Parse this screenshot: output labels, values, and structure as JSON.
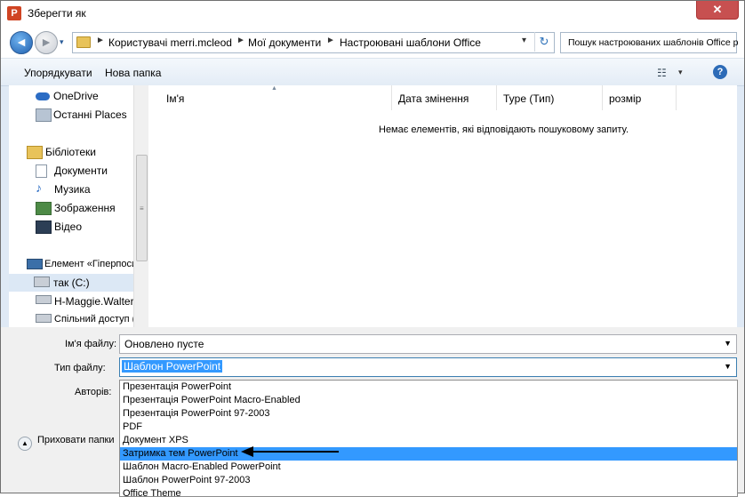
{
  "window": {
    "title": "Зберегти як",
    "close_glyph": "✕",
    "app_icon": "P"
  },
  "nav": {
    "back_glyph": "◄",
    "forward_glyph": "►",
    "history_glyph": "▾"
  },
  "breadcrumb": [
    "Користувачі mеrri.mcleod",
    "Мої документи",
    "Настроювані шаблони Office"
  ],
  "breadcrumb_sep": "►",
  "refresh_glyph": "↻",
  "search": {
    "placeholder": "Пошук настроюваних шаблонів Office р"
  },
  "toolbar": {
    "organize": "Упорядкувати",
    "new_folder": "Нова папка",
    "view_glyph": "☷",
    "view_drop": "▾",
    "help_glyph": "?"
  },
  "navpane": {
    "items": [
      {
        "label": "OneDrive",
        "icon": "cloud-icon"
      },
      {
        "label": "Останні Places",
        "icon": "recent-places-icon"
      },
      {
        "label": "Бібліотеки",
        "icon": "libraries-icon"
      },
      {
        "label": "Документи",
        "icon": "documents-icon"
      },
      {
        "label": "Музика",
        "icon": "music-icon"
      },
      {
        "label": "Зображення",
        "icon": "pictures-icon"
      },
      {
        "label": "Відео",
        "icon": "video-icon"
      },
      {
        "label": "Елемент «Гіперпосилання» в колекції «Стилі клітинок»",
        "icon": "computer-icon"
      },
      {
        "label": "так (C:)",
        "icon": "drive-icon"
      },
      {
        "label": "H-Maggie.Walter",
        "icon": "network-drive-icon"
      },
      {
        "label": "Спільний доступ (W:)",
        "icon": "network-drive-icon"
      }
    ]
  },
  "columns": [
    "Ім'я",
    "Дата змінення",
    "Type (Тип)",
    "розмір"
  ],
  "empty_message": "Немає елементів, які відповідають пошуковому запиту.",
  "fields": {
    "filename_label": "Ім'я файлу:",
    "filename_value": "Оновлено пусте",
    "filetype_label": "Тип файлу:",
    "filetype_value": "Шаблон PowerPoint",
    "authors_label": "Авторів:",
    "dropdown_glyph": "▼",
    "hide_folders": "Приховати папки",
    "hide_glyph": "▲"
  },
  "filetype_options": [
    "Презентація PowerPoint",
    "Презентація PowerPoint Macro-Enabled",
    "Презентація PowerPoint 97-2003",
    "PDF",
    "Документ XPS",
    "Затримка тем PowerPoint",
    "Шаблон Macro-Enabled PowerPoint",
    "Шаблон PowerPoint 97-2003",
    "Office Theme"
  ],
  "highlighted_option_index": 5
}
